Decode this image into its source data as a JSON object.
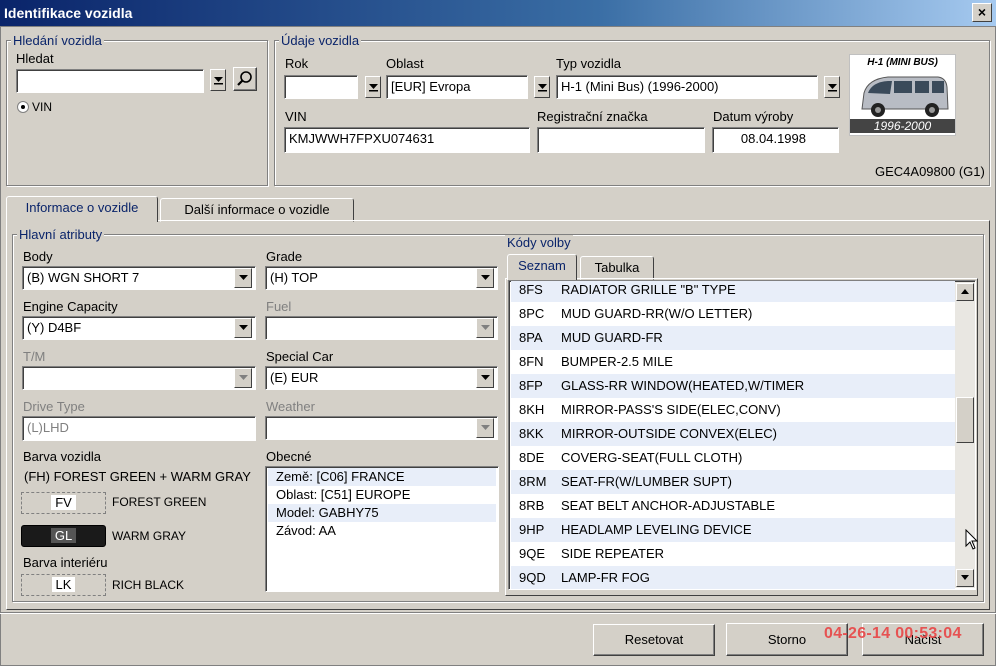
{
  "window": {
    "title": "Identifikace vozidla",
    "close": "×"
  },
  "search": {
    "legend": "Hledání vozidla",
    "label": "Hledat",
    "value": "",
    "radio_label": "VIN"
  },
  "vehicle": {
    "legend": "Údaje vozidla",
    "rok_label": "Rok",
    "rok_value": "",
    "oblast_label": "Oblast",
    "oblast_value": "[EUR]  Evropa",
    "typ_label": "Typ vozidla",
    "typ_value": "H-1 (Mini Bus) (1996-2000)",
    "vin_label": "VIN",
    "vin_value": "KMJWWH7FPXU074631",
    "reg_label": "Registrační značka",
    "reg_value": "",
    "datum_label": "Datum výroby",
    "datum_value": "08.04.1998",
    "image_caption_top": "H-1 (MINI BUS)",
    "image_caption_bottom": "1996-2000",
    "code": "GEC4A09800 (G1)"
  },
  "tabs": [
    {
      "label": "Informace o vozidle"
    },
    {
      "label": "Další informace o vozidle"
    }
  ],
  "main": {
    "legend": "Hlavní atributy",
    "body_label": "Body",
    "body_value": "(B) WGN SHORT 7",
    "grade_label": "Grade",
    "grade_value": "(H) TOP",
    "engine_label": "Engine Capacity",
    "engine_value": "(Y) D4BF",
    "fuel_label": "Fuel",
    "fuel_value": "",
    "tm_label": "T/M",
    "tm_value": "",
    "special_label": "Special Car",
    "special_value": "(E) EUR",
    "drive_label": "Drive Type",
    "drive_value": "(L)LHD",
    "weather_label": "Weather",
    "weather_value": "",
    "barva_label": "Barva vozidla",
    "barva_value": "(FH) FOREST GREEN + WARM GRAY",
    "color1_code": "FV",
    "color1_name": "FOREST GREEN",
    "color2_code": "GL",
    "color2_name": "WARM GRAY",
    "interior_label": "Barva interiéru",
    "interior_code": "LK",
    "interior_name": "RICH BLACK",
    "obecne_label": "Obecné",
    "obecne": [
      "Země: [C06]  FRANCE",
      "Oblast: [C51]  EUROPE",
      "Model: GABHY75",
      "Závod: AA"
    ]
  },
  "options": {
    "legend": "Kódy volby",
    "tabs": [
      {
        "label": "Seznam"
      },
      {
        "label": "Tabulka"
      }
    ],
    "rows": [
      {
        "code": "8FS",
        "desc": "RADIATOR GRILLE \"B\" TYPE"
      },
      {
        "code": "8PC",
        "desc": "MUD GUARD-RR(W/O LETTER)"
      },
      {
        "code": "8PA",
        "desc": "MUD GUARD-FR"
      },
      {
        "code": "8FN",
        "desc": "BUMPER-2.5 MILE"
      },
      {
        "code": "8FP",
        "desc": "GLASS-RR WINDOW(HEATED,W/TIMER"
      },
      {
        "code": "8KH",
        "desc": "MIRROR-PASS'S SIDE(ELEC,CONV)"
      },
      {
        "code": "8KK",
        "desc": "MIRROR-OUTSIDE CONVEX(ELEC)"
      },
      {
        "code": "8DE",
        "desc": "COVERG-SEAT(FULL CLOTH)"
      },
      {
        "code": "8RM",
        "desc": "SEAT-FR(W/LUMBER SUPT)"
      },
      {
        "code": "8RB",
        "desc": "SEAT BELT ANCHOR-ADJUSTABLE"
      },
      {
        "code": "9HP",
        "desc": "HEADLAMP LEVELING DEVICE"
      },
      {
        "code": "9QE",
        "desc": "SIDE REPEATER"
      },
      {
        "code": "9QD",
        "desc": "LAMP-FR FOG"
      }
    ]
  },
  "footer": {
    "reset": "Resetovat",
    "storno": "Storno",
    "load": "Načíst",
    "timestamp": "04-26-14 00:53:04"
  }
}
